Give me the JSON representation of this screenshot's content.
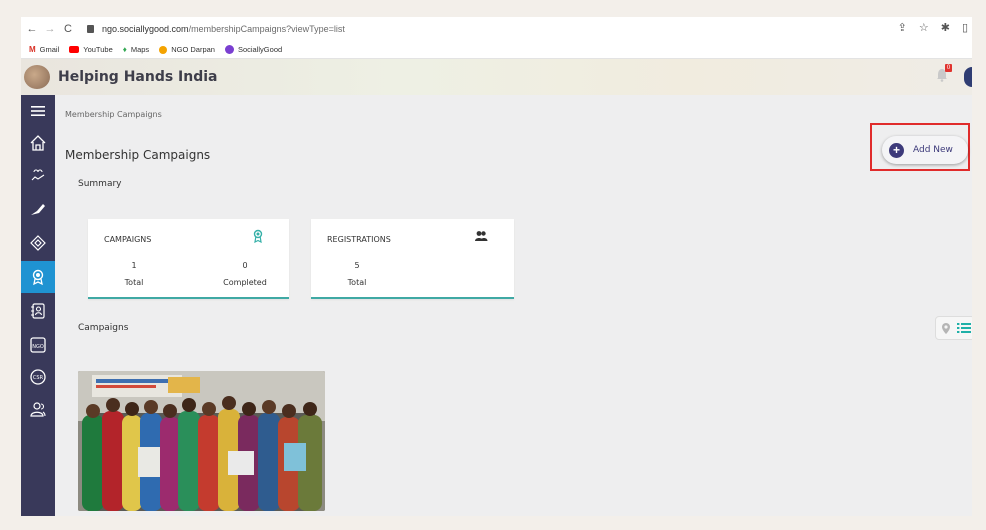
{
  "browser": {
    "url_host": "ngo.sociallygood.com",
    "url_path": "/membershipCampaigns?viewType=list",
    "bookmarks": [
      {
        "label": "Gmail",
        "icon": "gmail-icon",
        "color": "#d93025"
      },
      {
        "label": "YouTube",
        "icon": "youtube-icon",
        "color": "#ff0000"
      },
      {
        "label": "Maps",
        "icon": "maps-icon",
        "color": "#34a853"
      },
      {
        "label": "NGO Darpan",
        "icon": "ngo-darpan-icon",
        "color": "#f4a300"
      },
      {
        "label": "SociallyGood",
        "icon": "sociallygood-icon",
        "color": "#7a3fd1"
      }
    ]
  },
  "header": {
    "brand": "Helping Hands India",
    "notification_badge": "0"
  },
  "sidebar": {
    "items": [
      {
        "icon": "menu-icon"
      },
      {
        "icon": "home-icon"
      },
      {
        "icon": "donation-icon"
      },
      {
        "icon": "campaign-icon"
      },
      {
        "icon": "badge-icon"
      },
      {
        "icon": "membership-icon",
        "active": true
      },
      {
        "icon": "contacts-icon"
      },
      {
        "icon": "ngo-icon"
      },
      {
        "icon": "csr-icon"
      },
      {
        "icon": "volunteers-icon"
      }
    ]
  },
  "main": {
    "breadcrumb": "Membership Campaigns",
    "title": "Membership Campaigns",
    "add_new_label": "Add New",
    "summary_label": "Summary",
    "cards": {
      "campaigns": {
        "title": "CAMPAIGNS",
        "total_value": "1",
        "total_label": "Total",
        "completed_value": "0",
        "completed_label": "Completed"
      },
      "registrations": {
        "title": "REGISTRATIONS",
        "total_value": "5",
        "total_label": "Total"
      }
    },
    "campaigns_label": "Campaigns"
  },
  "colors": {
    "sidebar_bg": "#39395a",
    "sidebar_active": "#1f93d2",
    "card_accent": "#3fa9a4",
    "primary": "#3d3a7a",
    "highlight": "#e02b2b"
  }
}
